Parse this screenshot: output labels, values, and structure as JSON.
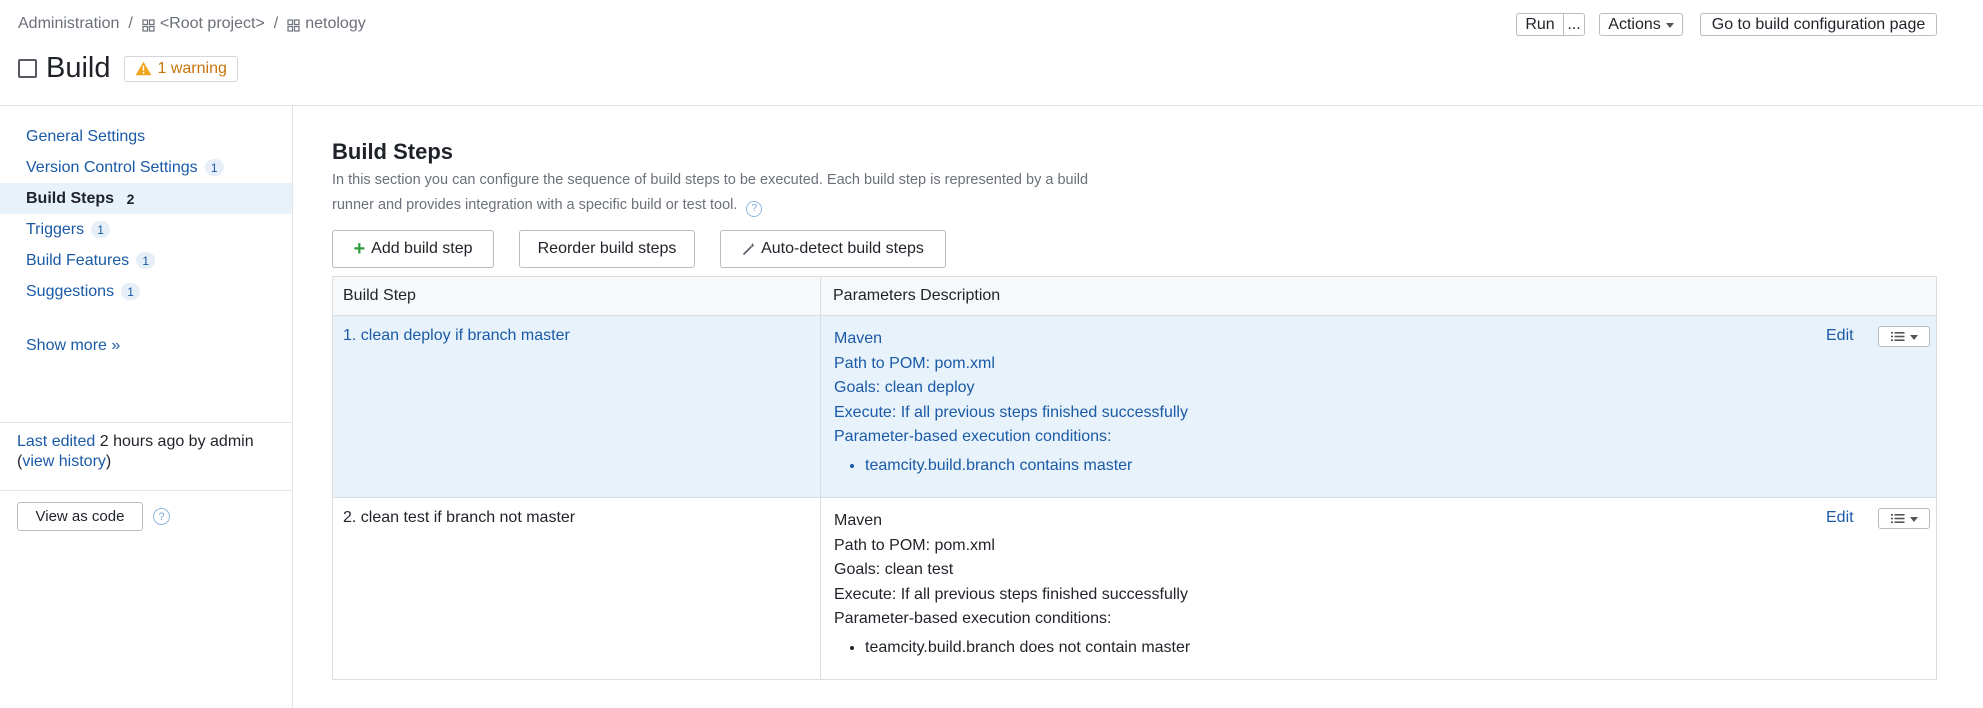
{
  "breadcrumb": {
    "root": "Administration",
    "project": "<Root project>",
    "subproject": "netology"
  },
  "header": {
    "title": "Build",
    "warning": "1 warning",
    "run_label": "Run",
    "more_label": "...",
    "actions_label": "Actions",
    "goto_label": "Go to build configuration page"
  },
  "sidebar": {
    "items": [
      {
        "label": "General Settings",
        "count": ""
      },
      {
        "label": "Version Control Settings",
        "count": "1"
      },
      {
        "label": "Build Steps",
        "count": "2"
      },
      {
        "label": "Triggers",
        "count": "1"
      },
      {
        "label": "Build Features",
        "count": "1"
      },
      {
        "label": "Suggestions",
        "count": "1"
      }
    ],
    "show_more": "Show more »",
    "last_edited_label": "Last edited",
    "last_edited_text": " 2 hours ago by admin",
    "view_history_open": "(",
    "view_history": "view history",
    "view_history_close": ")",
    "view_as_code": "View as code"
  },
  "main": {
    "section_title": "Build Steps",
    "description": "In this section you can configure the sequence of build steps to be executed. Each build step is represented by a build runner and provides integration with a specific build or test tool.",
    "add_step": "Add build step",
    "reorder_steps": "Reorder build steps",
    "autodetect_steps": "Auto-detect build steps",
    "table": {
      "col_step": "Build Step",
      "col_params": "Parameters Description",
      "rows": [
        {
          "name": "1. clean deploy if branch master",
          "runner": "Maven",
          "pom": "Path to POM: pom.xml",
          "goals": "Goals: clean deploy",
          "execute": "Execute: If all previous steps finished successfully",
          "conditions_label": "Parameter-based execution conditions:",
          "condition": "teamcity.build.branch contains master",
          "edit": "Edit"
        },
        {
          "name": "2. clean test if branch not master",
          "runner": "Maven",
          "pom": "Path to POM: pom.xml",
          "goals": "Goals: clean test",
          "execute": "Execute: If all previous steps finished successfully",
          "conditions_label": "Parameter-based execution conditions:",
          "condition": "teamcity.build.branch does not contain master",
          "edit": "Edit"
        }
      ]
    }
  },
  "colors": {
    "link": "#1a5aa6",
    "active_bg": "#e8f2fb",
    "warning": "#c9740d",
    "add_plus": "#2e9c3e"
  }
}
